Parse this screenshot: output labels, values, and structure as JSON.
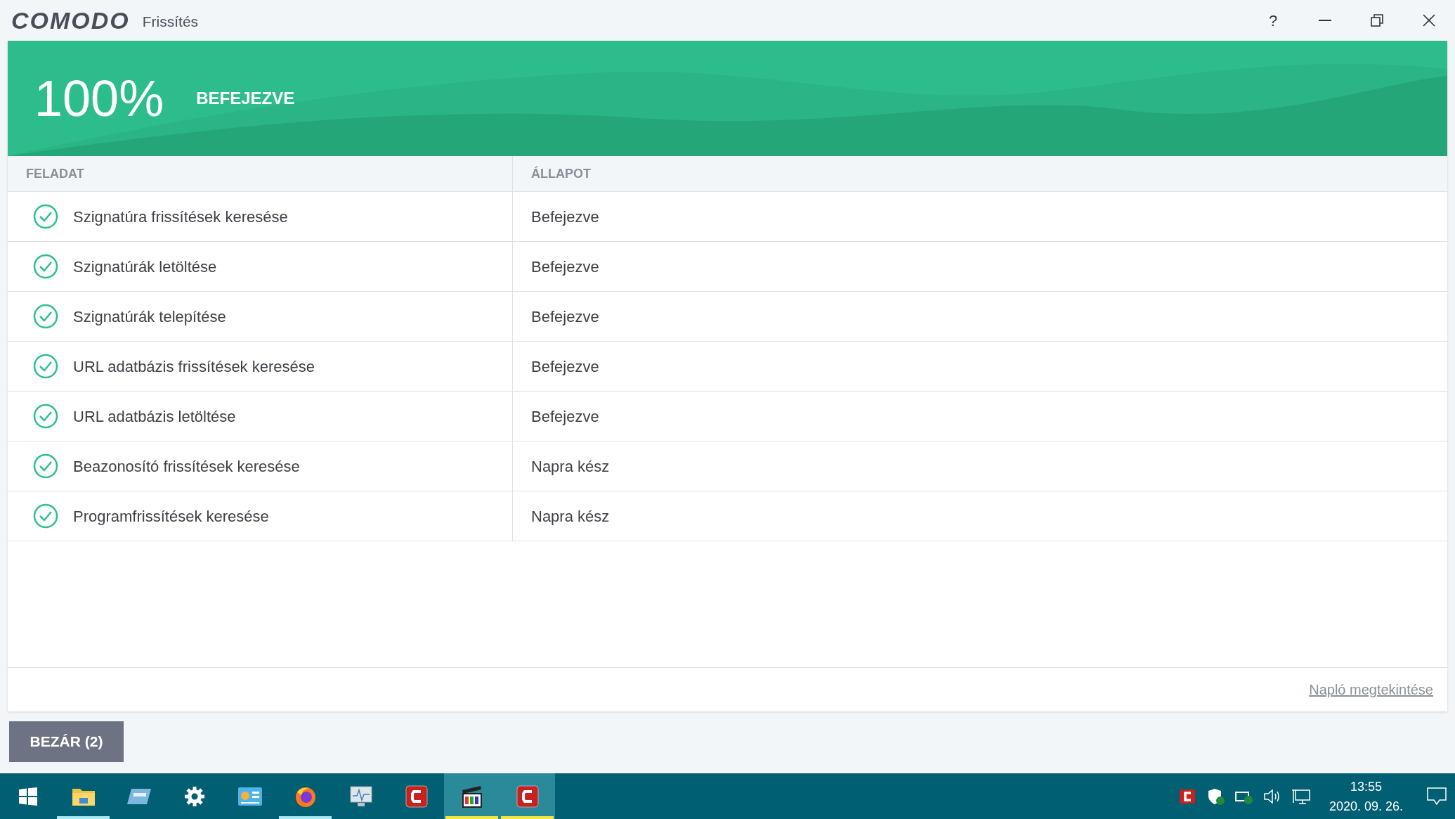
{
  "window": {
    "logo": "COMODO",
    "title": "Frissítés",
    "controls": [
      "?"
    ]
  },
  "banner": {
    "percent": "100%",
    "status": "BEFEJEZVE"
  },
  "table": {
    "columns": [
      "FELADAT",
      "ÁLLAPOT"
    ],
    "rows": [
      {
        "task": "Szignatúra frissítések keresése",
        "status": "Befejezve",
        "done": true
      },
      {
        "task": "Szignatúrák letöltése",
        "status": "Befejezve",
        "done": true
      },
      {
        "task": "Szignatúrák telepítése",
        "status": "Befejezve",
        "done": true
      },
      {
        "task": "URL adatbázis frissítések keresése",
        "status": "Befejezve",
        "done": true
      },
      {
        "task": "URL adatbázis letöltése",
        "status": "Befejezve",
        "done": true
      },
      {
        "task": "Beazonosító frissítések keresése",
        "status": "Napra kész",
        "done": true
      },
      {
        "task": "Programfrissítések keresése",
        "status": "Napra kész",
        "done": true
      }
    ]
  },
  "log_link": "Napló megtekintése",
  "close_button": "BEZÁR (2)",
  "taskbar": {
    "apps": [
      {
        "kind": "start",
        "running": false,
        "selected": false
      },
      {
        "kind": "folder",
        "running": true,
        "selected": false
      },
      {
        "kind": "card",
        "running": false,
        "selected": false
      },
      {
        "kind": "gear",
        "running": false,
        "selected": false
      },
      {
        "kind": "panel",
        "running": false,
        "selected": false
      },
      {
        "kind": "browser",
        "running": true,
        "selected": false
      },
      {
        "kind": "monitor",
        "running": false,
        "selected": false
      },
      {
        "kind": "shield-c",
        "running": false,
        "selected": false
      },
      {
        "kind": "clapper",
        "running": true,
        "selected": true
      },
      {
        "kind": "shield-c",
        "running": true,
        "selected": true
      }
    ],
    "time": "13:55",
    "date": "2020. 09. 26."
  }
}
